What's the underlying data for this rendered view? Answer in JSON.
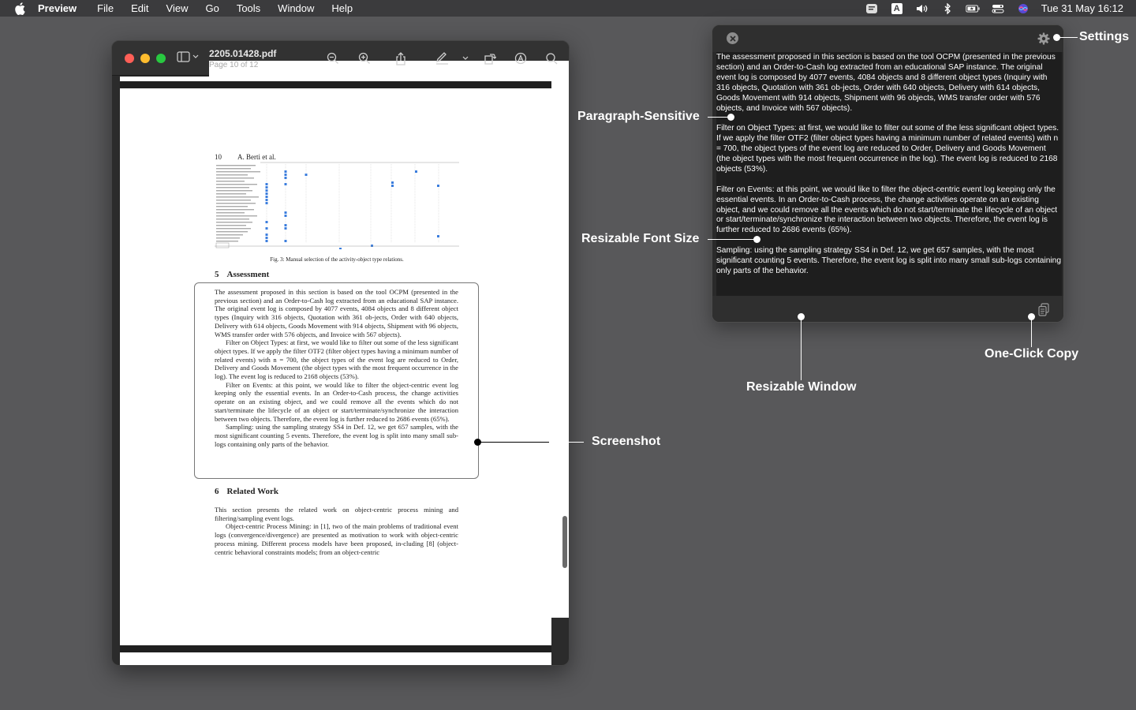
{
  "menubar": {
    "app_name": "Preview",
    "menus": [
      "File",
      "Edit",
      "View",
      "Go",
      "Tools",
      "Window",
      "Help"
    ],
    "clock": "Tue 31 May  16:12",
    "input_source": "A"
  },
  "preview": {
    "file_name": "2205.01428.pdf",
    "page_info": "Page 10 of 12",
    "pdf": {
      "page_number": "10",
      "running_head": "A. Berti et al.",
      "figure_caption": "Fig. 3: Manual selection of the activity-object type relations.",
      "section5_number": "5",
      "section5_title": "Assessment",
      "section5_p1": "The assessment proposed in this section is based on the tool OCPM (presented in the previous section) and an Order-to-Cash log extracted from an educational SAP instance. The original event log is composed by 4077 events, 4084 objects and 8 different object types (Inquiry with 316 objects, Quotation with 361 ob-jects, Order with 640 objects, Delivery with 614 objects, Goods Movement with 914 objects, Shipment with 96 objects, WMS transfer order with 576 objects, and Invoice with 567 objects).",
      "section5_p2": "Filter on Object Types: at first, we would like to filter out some of the less significant object types. If we apply the filter OTF2 (filter object types having a minimum number of related events) with n = 700, the object types of the event log are reduced to Order, Delivery and Goods Movement (the object types with the most frequent occurrence in the log). The event log is reduced to 2168 objects (53%).",
      "section5_p3": "Filter on Events: at this point, we would like to filter the object-centric event log keeping only the essential events. In an Order-to-Cash process, the change activities operate on an existing object, and we could remove all the events which do not start/terminate the lifecycle of an object or start/terminate/synchronize the interaction between two objects. Therefore, the event log is further reduced to 2686 events (65%).",
      "section5_p4": "Sampling: using the sampling strategy SS4 in Def. 12, we get 657 samples, with the most significant counting 5 events. Therefore, the event log is split into many small sub-logs containing only parts of the behavior.",
      "section6_number": "6",
      "section6_title": "Related Work",
      "section6_p1": "This section presents the related work on object-centric process mining and filtering/sampling event logs.",
      "section6_p2": "Object-centric Process Mining: in [1], two of the main problems of traditional event logs (convergence/divergence) are presented as motivation to work with object-centric process mining. Different process models have been proposed, in-cluding [8] (object-centric behavioral constraints models; from an object-centric"
    }
  },
  "panel": {
    "paragraphs": [
      "The assessment proposed in this section is based on the tool OCPM (presented in the previous section) and an Order-to-Cash log extracted from an educational SAP instance. The original event log is composed by 4077 events, 4084 objects and 8 different object types (Inquiry with 316 objects, Quotation with 361 ob-jects, Order with 640 objects, Delivery with 614 objects, Goods Movement with 914 objects, Shipment with 96 objects, WMS transfer order with 576 objects, and Invoice with 567 objects).",
      "Filter on Object Types: at first, we would like to filter out some of the less significant object types. If we apply the filter OTF2 (filter object types having a minimum number of related events) with n = 700, the object types of the event log are reduced to Order, Delivery and Goods Movement (the object types with the most frequent occurrence in the log). The event log is reduced to 2168 objects (53%).",
      "Filter on Events: at this point, we would like to filter the object-centric event log keeping only the essential events. In an Order-to-Cash process, the change activities operate on an existing object, and we could remove all the events which do not start/terminate the lifecycle of an object or start/terminate/synchronize the interaction between two objects. Therefore, the event log is further reduced to 2686 events (65%).",
      "Sampling: using the sampling strategy SS4 in Def. 12, we get 657 samples, with the most significant counting 5 events. Therefore, the event log is split into many small sub-logs containing only parts of the behavior."
    ]
  },
  "annotations": {
    "settings": "Settings",
    "paragraph_sensitive": "Paragraph-Sensitive",
    "resizable_font_size": "Resizable Font Size",
    "resizable_window": "Resizable Window",
    "one_click_copy": "One-Click Copy",
    "screenshot": "Screenshot"
  }
}
